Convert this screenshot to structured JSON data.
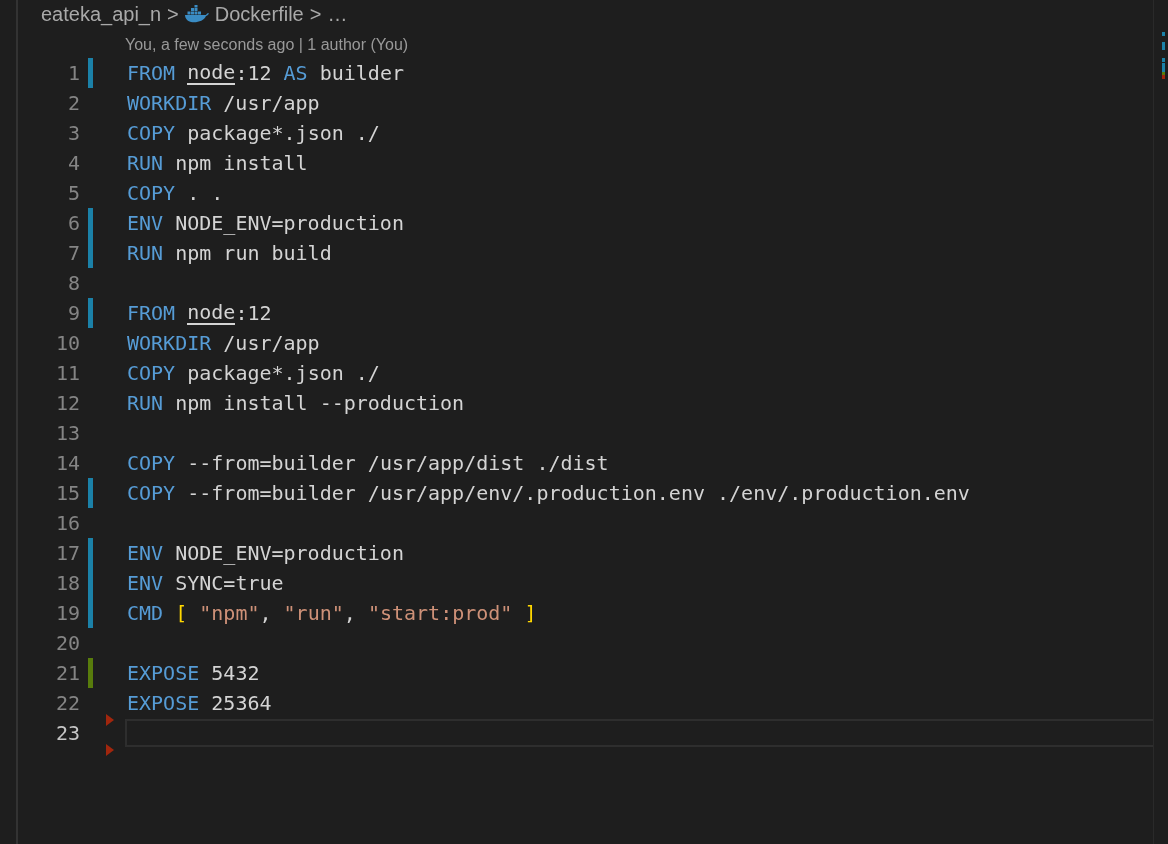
{
  "breadcrumb": {
    "folder": "eateka_api_n",
    "separator": ">",
    "file": "Dockerfile",
    "more": "…"
  },
  "codelens": "You, a few seconds ago | 1 author (You)",
  "lines": [
    {
      "number": "1",
      "modified": true,
      "added": false,
      "current": false,
      "deleted_below": false,
      "tokens": [
        {
          "text": "FROM ",
          "kind": "keyword"
        },
        {
          "text": "node",
          "kind": "plain",
          "underlined": true
        },
        {
          "text": ":12 ",
          "kind": "plain"
        },
        {
          "text": "AS ",
          "kind": "keyword"
        },
        {
          "text": "builder",
          "kind": "plain"
        }
      ]
    },
    {
      "number": "2",
      "modified": false,
      "added": false,
      "current": false,
      "deleted_below": false,
      "tokens": [
        {
          "text": "WORKDIR ",
          "kind": "keyword"
        },
        {
          "text": "/usr/app",
          "kind": "plain"
        }
      ]
    },
    {
      "number": "3",
      "modified": false,
      "added": false,
      "current": false,
      "deleted_below": false,
      "tokens": [
        {
          "text": "COPY ",
          "kind": "keyword"
        },
        {
          "text": "package*.json ./",
          "kind": "plain"
        }
      ]
    },
    {
      "number": "4",
      "modified": false,
      "added": false,
      "current": false,
      "deleted_below": false,
      "tokens": [
        {
          "text": "RUN ",
          "kind": "keyword"
        },
        {
          "text": "npm install",
          "kind": "plain"
        }
      ]
    },
    {
      "number": "5",
      "modified": false,
      "added": false,
      "current": false,
      "deleted_below": false,
      "tokens": [
        {
          "text": "COPY ",
          "kind": "keyword"
        },
        {
          "text": ". .",
          "kind": "plain"
        }
      ]
    },
    {
      "number": "6",
      "modified": true,
      "added": false,
      "current": false,
      "deleted_below": false,
      "tokens": [
        {
          "text": "ENV ",
          "kind": "keyword"
        },
        {
          "text": "NODE_ENV=production",
          "kind": "plain"
        }
      ]
    },
    {
      "number": "7",
      "modified": true,
      "added": false,
      "current": false,
      "deleted_below": false,
      "tokens": [
        {
          "text": "RUN ",
          "kind": "keyword"
        },
        {
          "text": "npm run build",
          "kind": "plain"
        }
      ]
    },
    {
      "number": "8",
      "modified": false,
      "added": false,
      "current": false,
      "deleted_below": false
    },
    {
      "number": "9",
      "modified": true,
      "added": false,
      "current": false,
      "deleted_below": false,
      "tokens": [
        {
          "text": "FROM ",
          "kind": "keyword"
        },
        {
          "text": "node",
          "kind": "plain",
          "underlined": true
        },
        {
          "text": ":12",
          "kind": "plain"
        }
      ]
    },
    {
      "number": "10",
      "modified": false,
      "added": false,
      "current": false,
      "deleted_below": false,
      "tokens": [
        {
          "text": "WORKDIR ",
          "kind": "keyword"
        },
        {
          "text": "/usr/app",
          "kind": "plain"
        }
      ]
    },
    {
      "number": "11",
      "modified": false,
      "added": false,
      "current": false,
      "deleted_below": false,
      "tokens": [
        {
          "text": "COPY ",
          "kind": "keyword"
        },
        {
          "text": "package*.json ./",
          "kind": "plain"
        }
      ]
    },
    {
      "number": "12",
      "modified": false,
      "added": false,
      "current": false,
      "deleted_below": false,
      "tokens": [
        {
          "text": "RUN ",
          "kind": "keyword"
        },
        {
          "text": "npm install --production",
          "kind": "plain"
        }
      ]
    },
    {
      "number": "13",
      "modified": false,
      "added": false,
      "current": false,
      "deleted_below": false
    },
    {
      "number": "14",
      "modified": false,
      "added": false,
      "current": false,
      "deleted_below": false,
      "tokens": [
        {
          "text": "COPY ",
          "kind": "keyword"
        },
        {
          "text": "--from=builder /usr/app/dist ./dist",
          "kind": "plain"
        }
      ]
    },
    {
      "number": "15",
      "modified": true,
      "added": false,
      "current": false,
      "deleted_below": false,
      "tokens": [
        {
          "text": "COPY ",
          "kind": "keyword"
        },
        {
          "text": "--from=builder /usr/app/env/.production.env ./env/.production.env",
          "kind": "plain"
        }
      ]
    },
    {
      "number": "16",
      "modified": false,
      "added": false,
      "current": false,
      "deleted_below": false
    },
    {
      "number": "17",
      "modified": true,
      "added": false,
      "current": false,
      "deleted_below": false,
      "tokens": [
        {
          "text": "ENV ",
          "kind": "keyword"
        },
        {
          "text": "NODE_ENV=production",
          "kind": "plain"
        }
      ]
    },
    {
      "number": "18",
      "modified": true,
      "added": false,
      "current": false,
      "deleted_below": false,
      "tokens": [
        {
          "text": "ENV ",
          "kind": "keyword"
        },
        {
          "text": "SYNC=true",
          "kind": "plain"
        }
      ]
    },
    {
      "number": "19",
      "modified": true,
      "added": false,
      "current": false,
      "deleted_below": false,
      "tokens": [
        {
          "text": "CMD ",
          "kind": "keyword"
        },
        {
          "text": "[ ",
          "kind": "bracket"
        },
        {
          "text": "\"npm\"",
          "kind": "string"
        },
        {
          "text": ", ",
          "kind": "plain"
        },
        {
          "text": "\"run\"",
          "kind": "string"
        },
        {
          "text": ", ",
          "kind": "plain"
        },
        {
          "text": "\"start:prod\"",
          "kind": "string"
        },
        {
          "text": " ]",
          "kind": "bracket"
        }
      ]
    },
    {
      "number": "20",
      "modified": false,
      "added": false,
      "current": false,
      "deleted_below": false
    },
    {
      "number": "21",
      "modified": false,
      "added": true,
      "current": false,
      "deleted_below": false,
      "tokens": [
        {
          "text": "EXPOSE ",
          "kind": "keyword"
        },
        {
          "text": "5432",
          "kind": "plain"
        }
      ]
    },
    {
      "number": "22",
      "modified": false,
      "added": false,
      "current": false,
      "deleted_below": true,
      "tokens": [
        {
          "text": "EXPOSE ",
          "kind": "keyword"
        },
        {
          "text": "25364",
          "kind": "plain"
        }
      ]
    },
    {
      "number": "23",
      "modified": false,
      "added": false,
      "current": true,
      "deleted_below": true
    }
  ]
}
